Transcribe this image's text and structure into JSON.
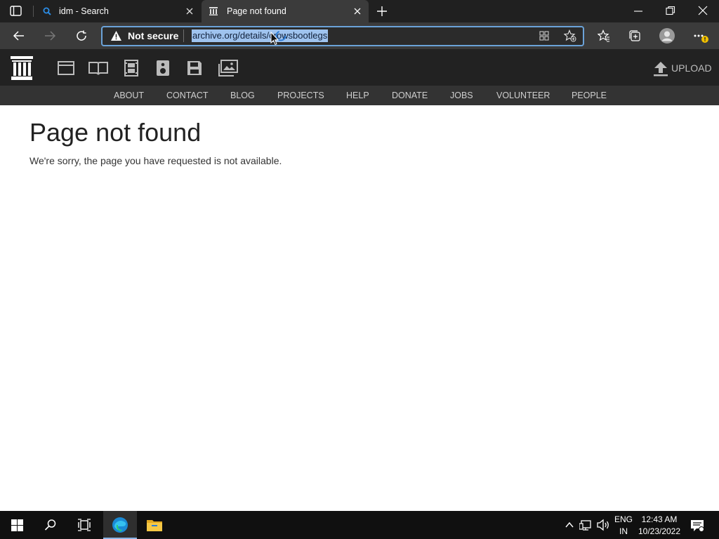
{
  "browser": {
    "tabs": [
      {
        "title": "idm - Search",
        "active": false,
        "icon": "search-icon"
      },
      {
        "title": "Page not found",
        "active": true,
        "icon": "archive-icon"
      }
    ],
    "security_label": "Not secure",
    "url": "archive.org/details/crowsbootlegs",
    "accent": "#6ba3d9",
    "selection_color": "#9fc3ee"
  },
  "site": {
    "media_icons": [
      "web-icon",
      "texts-icon",
      "video-icon",
      "audio-icon",
      "software-icon",
      "images-icon"
    ],
    "upload_label": "UPLOAD",
    "nav": [
      "ABOUT",
      "CONTACT",
      "BLOG",
      "PROJECTS",
      "HELP",
      "DONATE",
      "JOBS",
      "VOLUNTEER",
      "PEOPLE"
    ]
  },
  "page": {
    "title": "Page not found",
    "message": "We're sorry, the page you have requested is not available."
  },
  "taskbar": {
    "lang_line1": "ENG",
    "lang_line2": "IN",
    "time": "12:43 AM",
    "date": "10/23/2022"
  }
}
